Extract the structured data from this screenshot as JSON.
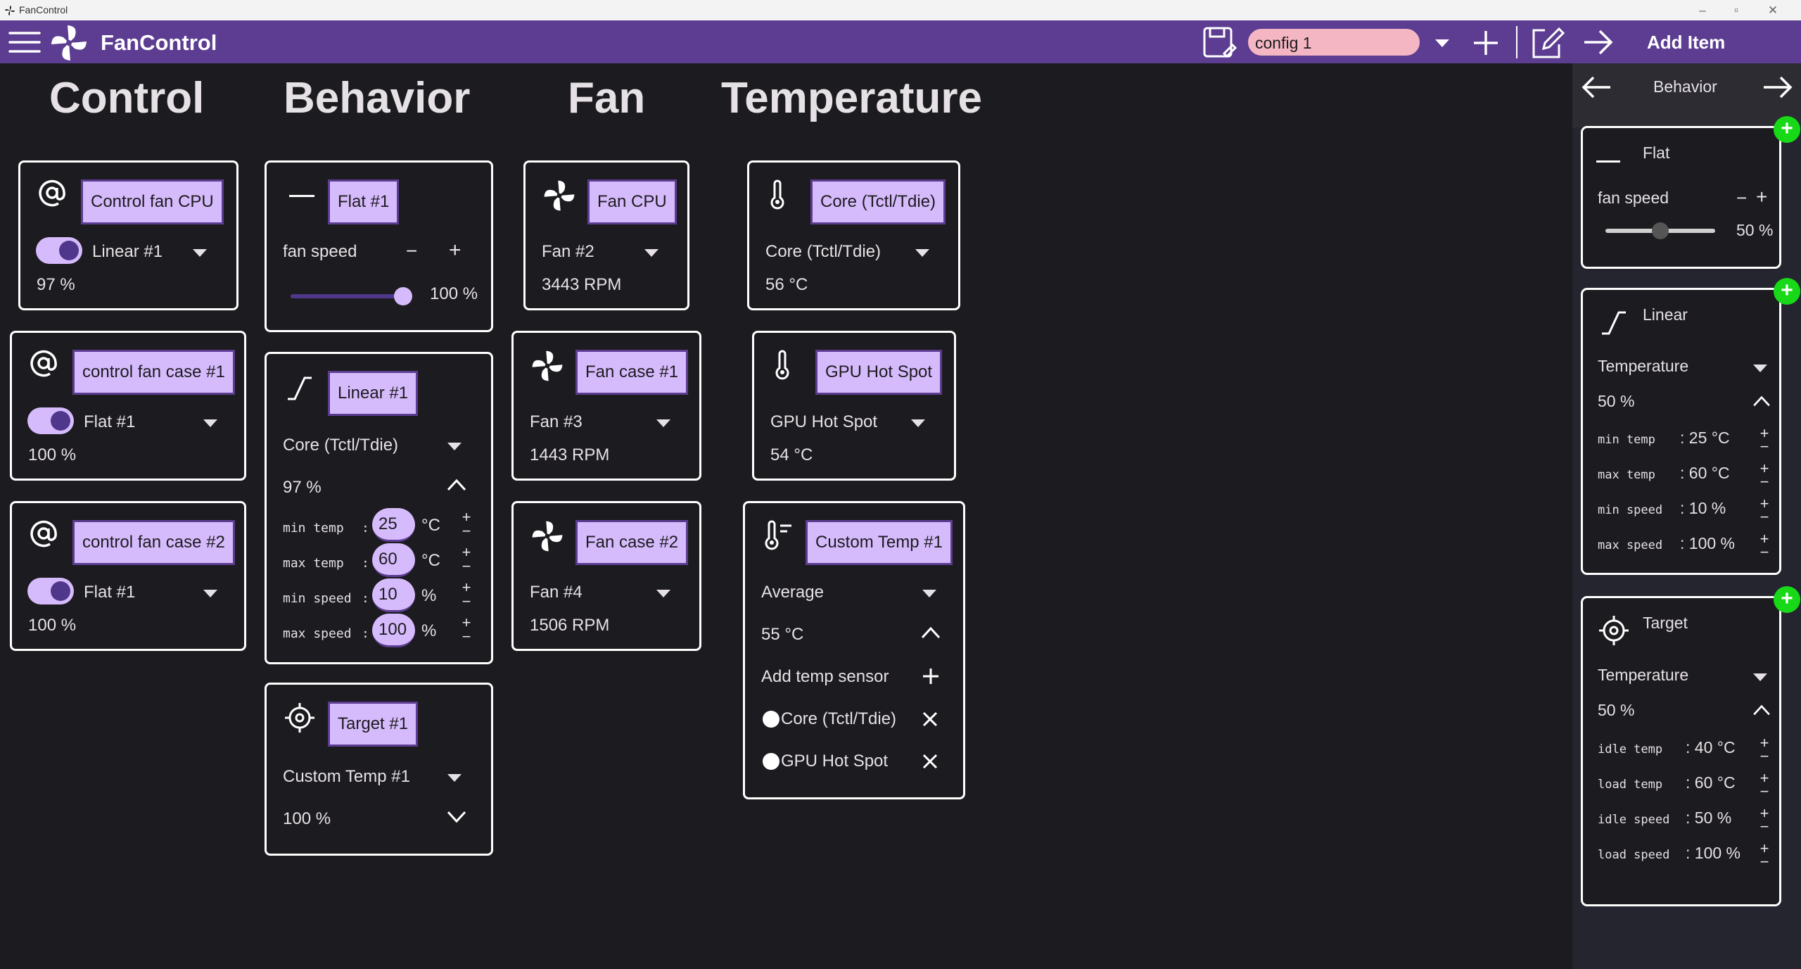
{
  "window": {
    "title": "FanControl"
  },
  "appbar": {
    "app_name": "FanControl",
    "config_value": "config 1",
    "add_item_label": "Add Item"
  },
  "columns": {
    "control": "Control",
    "behavior": "Behavior",
    "fan": "Fan",
    "temperature": "Temperature"
  },
  "controls": [
    {
      "name": "Control fan CPU",
      "curve": "Linear #1",
      "value": "97 %"
    },
    {
      "name": "control fan case #1",
      "curve": "Flat #1",
      "value": "100 %"
    },
    {
      "name": "control fan case #2",
      "curve": "Flat #1",
      "value": "100 %"
    }
  ],
  "behaviors": {
    "flat": {
      "name": "Flat #1",
      "label": "fan speed",
      "minus": "−",
      "plus": "+",
      "value": "100 %",
      "level": 1.0
    },
    "linear": {
      "name": "Linear #1",
      "source": "Core (Tctl/Tdie)",
      "value": "97 %",
      "rows": [
        {
          "label": "min temp",
          "sep": ":",
          "value": "25",
          "unit": "°C"
        },
        {
          "label": "max temp",
          "sep": ":",
          "value": "60",
          "unit": "°C"
        },
        {
          "label": "min speed",
          "sep": ":",
          "value": "10",
          "unit": "%"
        },
        {
          "label": "max speed",
          "sep": ":",
          "value": "100",
          "unit": "%"
        }
      ]
    },
    "target": {
      "name": "Target #1",
      "source": "Custom Temp #1",
      "value": "100 %"
    }
  },
  "fans": [
    {
      "name": "Fan CPU",
      "sensor": "Fan #2",
      "rpm": "3443 RPM"
    },
    {
      "name": "Fan case #1",
      "sensor": "Fan #3",
      "rpm": "1443 RPM"
    },
    {
      "name": "Fan case #2",
      "sensor": "Fan #4",
      "rpm": "1506 RPM"
    }
  ],
  "temps": [
    {
      "name": "Core (Tctl/Tdie)",
      "sensor": "Core (Tctl/Tdie)",
      "value": "56 °C"
    },
    {
      "name": "GPU Hot Spot",
      "sensor": "GPU Hot Spot",
      "value": "54 °C"
    }
  ],
  "custom_temp": {
    "name": "Custom Temp #1",
    "mode": "Average",
    "value": "55 °C",
    "add_label": "Add temp sensor",
    "sensors": [
      "Core (Tctl/Tdie)",
      "GPU Hot Spot"
    ]
  },
  "side": {
    "nav_title": "Behavior",
    "flat": {
      "title": "Flat",
      "label": "fan speed",
      "value": "50 %",
      "level": 0.5
    },
    "linear": {
      "title": "Linear",
      "source": "Temperature",
      "value": "50 %",
      "rows": [
        {
          "label": "min temp",
          "value": ": 25 °C"
        },
        {
          "label": "max temp",
          "value": ": 60 °C"
        },
        {
          "label": "min speed",
          "value": ": 10 %"
        },
        {
          "label": "max speed",
          "value": ": 100 %"
        }
      ]
    },
    "target": {
      "title": "Target",
      "source": "Temperature",
      "value": "50 %",
      "rows": [
        {
          "label": "idle temp",
          "value": ": 40 °C"
        },
        {
          "label": "load temp",
          "value": ": 60 °C"
        },
        {
          "label": "idle speed",
          "value": ": 50 %"
        },
        {
          "label": "load speed",
          "value": ": 100 %"
        }
      ]
    }
  },
  "colors": {
    "appbar": "#5c3d91",
    "pill": "#d6bbfc",
    "accent_dark": "#4f378b",
    "add_green": "#17d917",
    "background": "#1c1b1f"
  }
}
